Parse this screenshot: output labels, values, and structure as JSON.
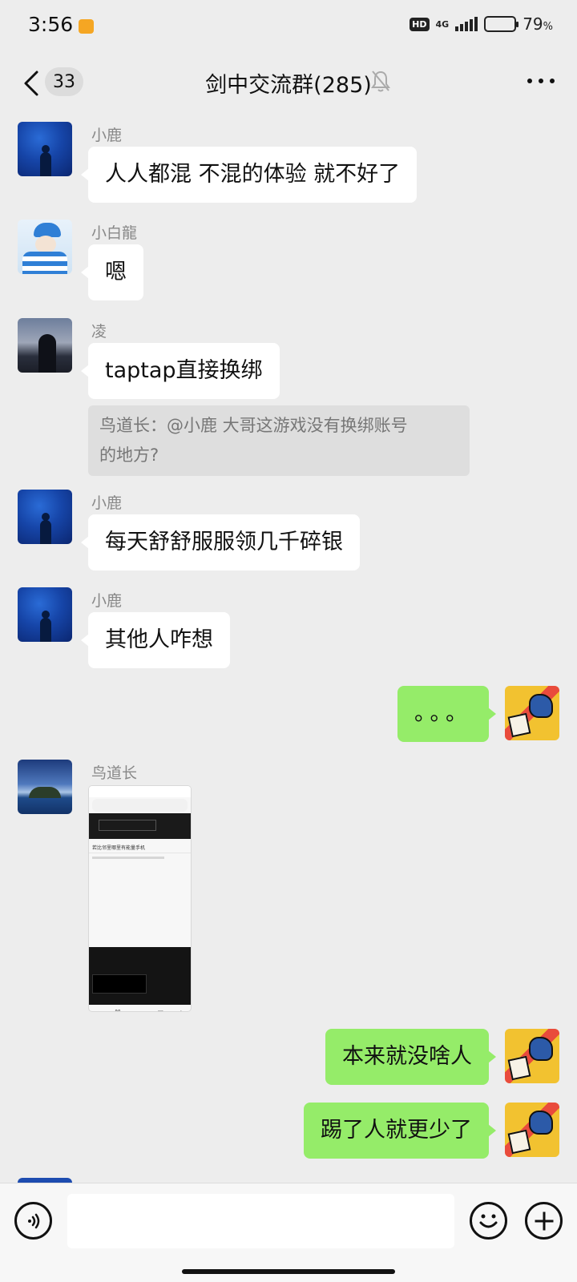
{
  "status_bar": {
    "time": "3:56",
    "hd": "HD",
    "network": "4G",
    "battery_percent": "79",
    "battery_unit": "%",
    "battery_level": 0.79
  },
  "nav": {
    "unread_count": "33",
    "title": "剑中交流群(285)",
    "icons": [
      "back-icon",
      "mute-bell-icon",
      "more-icon"
    ]
  },
  "messages": [
    {
      "side": "left",
      "sender": "小鹿",
      "text": "人人都混 不混的体验 就不好了",
      "avatar": "deer-avatar"
    },
    {
      "side": "left",
      "sender": "小白龍",
      "text": "嗯",
      "avatar": "dragon-avatar"
    },
    {
      "side": "left",
      "sender": "凌",
      "text": "taptap直接换绑",
      "avatar": "ling-avatar",
      "quote_line1": "鸟道长：@小鹿 大哥这游戏没有换绑账号",
      "quote_line2": "的地方?"
    },
    {
      "side": "left",
      "sender": "小鹿",
      "text": "每天舒舒服服领几千碎银",
      "avatar": "deer-avatar"
    },
    {
      "side": "left",
      "sender": "小鹿",
      "text": "其他人咋想",
      "avatar": "deer-avatar"
    },
    {
      "side": "right",
      "text": "。。。",
      "avatar": "self-avatar"
    },
    {
      "side": "left",
      "sender": "鸟道长",
      "type": "image",
      "avatar": "bird-avatar",
      "image_caption": "若比邻里哪里有能量手机"
    },
    {
      "side": "right",
      "text": "本来就没啥人",
      "avatar": "self-avatar"
    },
    {
      "side": "right",
      "text": "踢了人就更少了",
      "avatar": "self-avatar"
    }
  ],
  "input_bar": {
    "text_value": "",
    "icons": [
      "voice-icon",
      "emoji-icon",
      "plus-icon"
    ]
  },
  "colors": {
    "background": "#ededed",
    "bubble_left": "#ffffff",
    "bubble_right": "#95ec69",
    "sender_name": "#888888",
    "quote_bg": "#dedede"
  }
}
